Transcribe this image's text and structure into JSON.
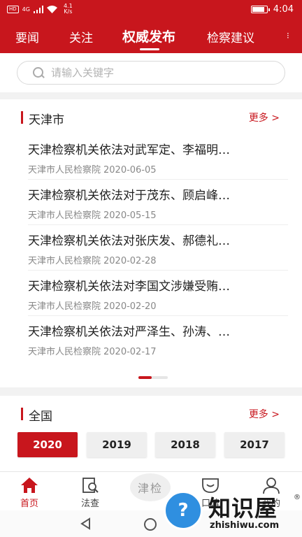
{
  "status_bar": {
    "network": "HD",
    "signal": "4G",
    "speed": "4.1",
    "speed_unit": "K/s",
    "time": "4:04",
    "battery_level": 0.85
  },
  "tabs": [
    {
      "label": "要闻",
      "active": false
    },
    {
      "label": "关注",
      "active": false
    },
    {
      "label": "权威发布",
      "active": true
    },
    {
      "label": "检察建议",
      "active": false
    }
  ],
  "search": {
    "placeholder": "请输入关键字",
    "value": ""
  },
  "section_tianjin": {
    "title": "天津市",
    "more": "更多 >",
    "items": [
      {
        "title": "天津检察机关依法对武军定、李福明…",
        "source": "天津市人民检察院",
        "date": "2020-06-05"
      },
      {
        "title": "天津检察机关依法对于茂东、顾启峰…",
        "source": "天津市人民检察院",
        "date": "2020-05-15"
      },
      {
        "title": "天津检察机关依法对张庆发、郝德礼…",
        "source": "天津市人民检察院",
        "date": "2020-02-28"
      },
      {
        "title": "天津检察机关依法对李国文涉嫌受贿…",
        "source": "天津市人民检察院",
        "date": "2020-02-20"
      },
      {
        "title": "天津检察机关依法对严泽生、孙涛、…",
        "source": "天津市人民检察院",
        "date": "2020-02-17"
      }
    ],
    "pager": {
      "pages": 2,
      "current": 1
    }
  },
  "section_national": {
    "title": "全国",
    "more": "更多 >",
    "years": [
      {
        "label": "2020",
        "active": true
      },
      {
        "label": "2019",
        "active": false
      },
      {
        "label": "2018",
        "active": false
      },
      {
        "label": "2017",
        "active": false
      }
    ]
  },
  "bottom_nav": {
    "items": [
      {
        "label": "首页",
        "icon": "home-icon",
        "active": true
      },
      {
        "label": "法查",
        "icon": "law-search-icon",
        "active": false
      },
      {
        "label": "口碑",
        "icon": "reputation-icon",
        "active": false
      },
      {
        "label": "我的",
        "icon": "user-icon",
        "active": false
      }
    ],
    "center_logo": "津检"
  },
  "watermark": {
    "name": "知识屋",
    "url": "zhishiwu.com",
    "mark": "®"
  },
  "colors": {
    "brand": "#c8161d",
    "text": "#222222",
    "meta": "#888888"
  }
}
